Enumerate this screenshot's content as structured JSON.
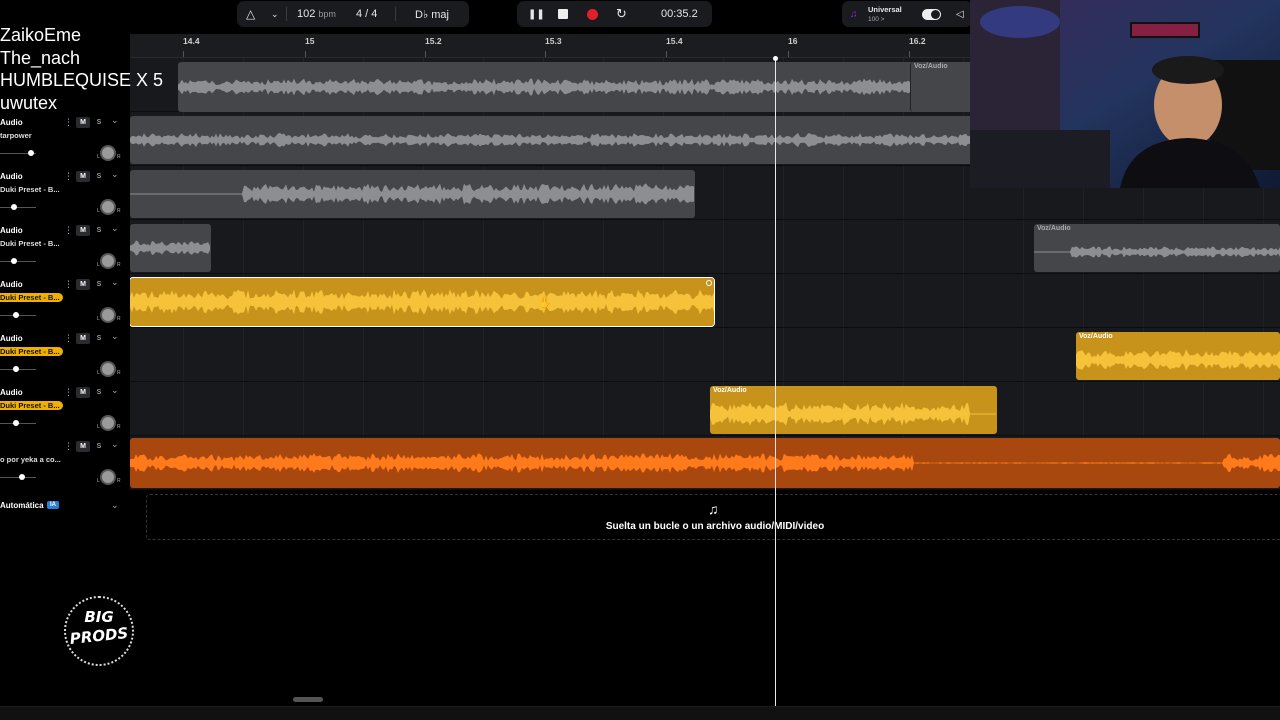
{
  "overlay": {
    "names": [
      "ZaikoEme",
      "The_nach",
      "HUMBLEQUISE X 5",
      "uwutex"
    ]
  },
  "transport": {
    "tempo_value": "102",
    "tempo_unit": "bpm",
    "time_signature": "4 / 4",
    "key": "D♭ maj",
    "time": "00:35.2",
    "preset_name": "Universal",
    "preset_value": "100 >"
  },
  "ruler": {
    "ticks": [
      "14.4",
      "15",
      "15.2",
      "15.3",
      "15.4",
      "16",
      "16.2"
    ]
  },
  "tracks": [
    {
      "name": "Audio",
      "sub": "tarpower",
      "highlight": false,
      "volume": 0.85
    },
    {
      "name": "Audio",
      "sub": "Duki Preset - B...",
      "highlight": false,
      "volume": 0.4
    },
    {
      "name": "Audio",
      "sub": "Duki Preset - B...",
      "highlight": false,
      "volume": 0.4
    },
    {
      "name": "Audio",
      "sub": "Duki Preset - B...",
      "highlight": true,
      "volume": 0.45
    },
    {
      "name": "Audio",
      "sub": "Duki Preset - B...",
      "highlight": true,
      "volume": 0.45
    },
    {
      "name": "Audio",
      "sub": "Duki Preset - B...",
      "highlight": true,
      "volume": 0.45
    },
    {
      "name": "",
      "sub": "o por yeka a co...",
      "highlight": false,
      "volume": 0.6
    }
  ],
  "track_controls": {
    "mute": "M",
    "solo": "S",
    "more": "⋮",
    "expand": "⌄",
    "left": "L",
    "right": "R"
  },
  "clip_label": "Voz/Audio",
  "automation": {
    "label": "Automática",
    "badge": "IA"
  },
  "dropzone": {
    "text": "Suelta un bucle o un archivo audio/MIDI/video"
  },
  "logo": {
    "line1": "BIG",
    "line2": "PRODS"
  },
  "colors": {
    "gold_clip": "#c7931a",
    "gold_wave": "#f5c23a",
    "orange_clip": "#a8470e",
    "orange_wave": "#ff7a1a",
    "gray_clip": "#45464a",
    "gray_wave": "#8d8e92",
    "record": "#e0202a",
    "ia_badge": "#2c7fd6"
  }
}
